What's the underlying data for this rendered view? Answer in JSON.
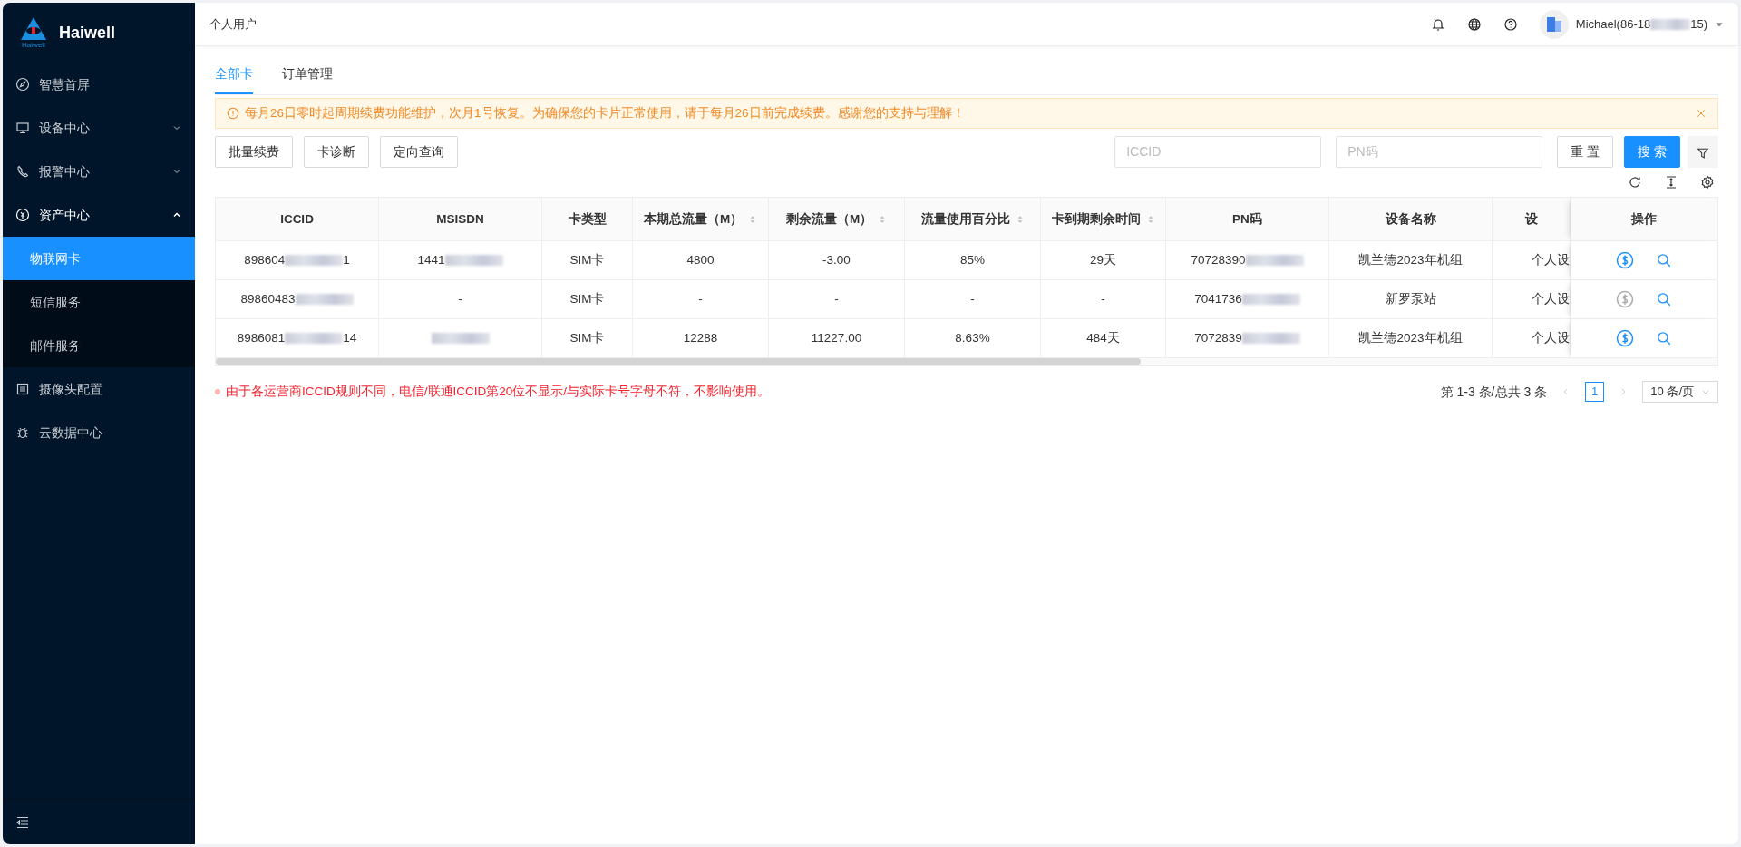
{
  "sidebar": {
    "brand": "Haiwell",
    "logo_caption": "Haiwell",
    "items": [
      {
        "label": "智慧首屏",
        "selected": false
      },
      {
        "label": "设备中心",
        "expanded": false,
        "selected": false
      },
      {
        "label": "报警中心",
        "expanded": false,
        "selected": false
      },
      {
        "label": "资产中心",
        "expanded": true,
        "selected": false,
        "children": [
          {
            "label": "物联网卡",
            "selected": true
          },
          {
            "label": "短信服务",
            "selected": false
          },
          {
            "label": "邮件服务",
            "selected": false
          }
        ]
      },
      {
        "label": "摄像头配置",
        "selected": false
      },
      {
        "label": "云数据中心",
        "selected": false
      }
    ]
  },
  "header": {
    "breadcrumb": "个人用户",
    "user": {
      "prefix": "Michael(86-18",
      "suffix": "15)",
      "masked": true
    }
  },
  "tabs": [
    {
      "label": "全部卡",
      "selected": true
    },
    {
      "label": "订单管理",
      "selected": false
    }
  ],
  "alert": {
    "text": "每月26日零时起周期续费功能维护，次月1号恢复。为确保您的卡片正常使用，请于每月26日前完成续费。感谢您的支持与理解！"
  },
  "actions": [
    "批量续费",
    "卡诊断",
    "定向查询"
  ],
  "search": {
    "fields": [
      {
        "placeholder": "ICCID"
      },
      {
        "placeholder": "PN码"
      }
    ],
    "reset": "重 置",
    "submit": "搜 索"
  },
  "table": {
    "columns": [
      {
        "label": "ICCID",
        "sortable": false
      },
      {
        "label": "MSISDN",
        "sortable": false
      },
      {
        "label": "卡类型",
        "sortable": false
      },
      {
        "label": "本期总流量（M）",
        "sortable": true
      },
      {
        "label": "剩余流量（M）",
        "sortable": true
      },
      {
        "label": "流量使用百分比",
        "sortable": true
      },
      {
        "label": "卡到期剩余时间",
        "sortable": true
      },
      {
        "label": "PN码",
        "sortable": false
      },
      {
        "label": "设备名称",
        "sortable": false
      },
      {
        "label": "设",
        "sortable": false
      },
      {
        "label": "操作",
        "sortable": false
      }
    ],
    "rows": [
      {
        "iccid": {
          "prefix": "898604",
          "suffix": "1",
          "masked": true
        },
        "msisdn": {
          "prefix": "1441",
          "masked": true
        },
        "type": "SIM卡",
        "total": "4800",
        "remaining": "-3.00",
        "percent": "85%",
        "days": "29天",
        "pn": {
          "prefix": "70728390",
          "masked": true
        },
        "device": "凯兰德2023年机组",
        "device_type": "个人设",
        "renew_enabled": true
      },
      {
        "iccid": {
          "prefix": "89860483",
          "masked": true
        },
        "msisdn": {
          "prefix": "-",
          "masked": false
        },
        "type": "SIM卡",
        "total": "-",
        "remaining": "-",
        "percent": "-",
        "days": "-",
        "pn": {
          "prefix": "7041736",
          "masked": true
        },
        "device": "新罗泵站",
        "device_type": "个人设",
        "renew_enabled": false
      },
      {
        "iccid": {
          "prefix": "8986081",
          "suffix": "14",
          "masked": true
        },
        "msisdn": {
          "masked": true
        },
        "type": "SIM卡",
        "total": "12288",
        "remaining": "11227.00",
        "percent": "8.63%",
        "days": "484天",
        "pn": {
          "prefix": "7072839",
          "masked": true
        },
        "device": "凯兰德2023年机组",
        "device_type": "个人设",
        "renew_enabled": true
      }
    ]
  },
  "note": "由于各运营商ICCID规则不同，电信/联通ICCID第20位不显示/与实际卡号字母不符，不影响使用。",
  "pagination": {
    "summary": "第 1-3 条/总共 3 条",
    "pages": [
      {
        "label": "1",
        "selected": true
      }
    ],
    "page_size": "10 条/页"
  }
}
